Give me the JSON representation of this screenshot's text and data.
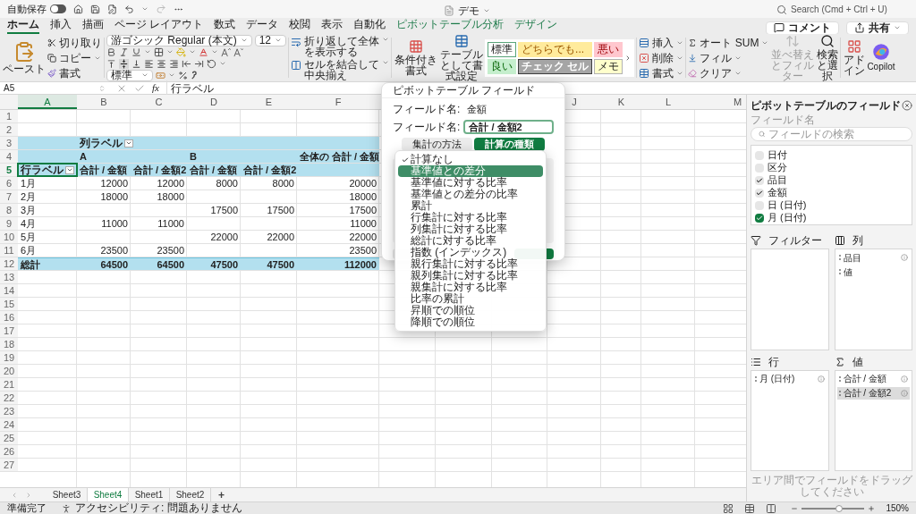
{
  "title_bar": {
    "autosave_label": "自動保存",
    "autosave_on": false,
    "title": "デモ",
    "search_placeholder": "Search (Cmd + Ctrl + U)"
  },
  "tabs": [
    {
      "label": "ホーム",
      "selected": true,
      "kind": "standard"
    },
    {
      "label": "挿入",
      "selected": false,
      "kind": "standard"
    },
    {
      "label": "描画",
      "selected": false,
      "kind": "standard"
    },
    {
      "label": "ページ レイアウト",
      "selected": false,
      "kind": "standard"
    },
    {
      "label": "数式",
      "selected": false,
      "kind": "standard"
    },
    {
      "label": "データ",
      "selected": false,
      "kind": "standard"
    },
    {
      "label": "校閲",
      "selected": false,
      "kind": "standard"
    },
    {
      "label": "表示",
      "selected": false,
      "kind": "standard"
    },
    {
      "label": "自動化",
      "selected": false,
      "kind": "standard"
    },
    {
      "label": "ピボットテーブル分析",
      "selected": false,
      "kind": "contextual"
    },
    {
      "label": "デザイン",
      "selected": false,
      "kind": "contextual"
    }
  ],
  "header_buttons": [
    {
      "label": "コメント",
      "kind": "comment"
    },
    {
      "label": "共有",
      "kind": "share"
    }
  ],
  "ribbon": {
    "paste": "ペースト",
    "cut": "切り取り",
    "copy": "コピー",
    "format_painter": "書式",
    "font_name": "游ゴシック Regular (本文)",
    "font_size": "12",
    "wrap": "折り返して全体を表示する",
    "merge": "セルを結合して中央揃え",
    "number_format": "標準",
    "conditional": "条件付き書式",
    "table_format": "テーブルとして書式設定",
    "cell_styles": [
      {
        "label": "標準",
        "kind": "normal"
      },
      {
        "label": "どちらでも...",
        "kind": "neutral"
      },
      {
        "label": "悪い",
        "kind": "bad"
      },
      {
        "label": "良い",
        "kind": "good"
      },
      {
        "label": "チェック セル",
        "kind": "check"
      },
      {
        "label": "メモ",
        "kind": "note"
      }
    ],
    "cells": [
      {
        "label": "挿入",
        "kind": "insert"
      },
      {
        "label": "削除",
        "kind": "delete"
      },
      {
        "label": "書式",
        "kind": "format"
      }
    ],
    "autosum": "オート SUM",
    "fill": "フィル",
    "clear": "クリア",
    "sort": {
      "label": "並べ替えとフィルター",
      "disabled": true
    },
    "find": "検索と選択",
    "addins": "アドイン",
    "copilot": "Copilot"
  },
  "formula_bar": {
    "cell": "A5",
    "function_symbol": "fx",
    "content": "行ラベル"
  },
  "grid": {
    "columns": [
      {
        "label": "A",
        "selected": true
      },
      {
        "label": "B",
        "selected": false
      },
      {
        "label": "C",
        "selected": false
      },
      {
        "label": "D",
        "selected": false
      },
      {
        "label": "E",
        "selected": false
      },
      {
        "label": "F",
        "selected": false
      },
      null,
      null,
      null,
      {
        "label": "J",
        "selected": false
      },
      {
        "label": "K",
        "selected": false
      },
      {
        "label": "L",
        "selected": false
      },
      {
        "label": "M",
        "selected": false
      }
    ],
    "rows": [
      {
        "number": "1",
        "kind": "blank",
        "selected": false
      },
      {
        "number": "2",
        "kind": "blank",
        "selected": false
      },
      {
        "number": "3",
        "kind": "header",
        "selected": false,
        "cells": [
          null,
          {
            "text": "列ラベル",
            "filter": true
          },
          null,
          null,
          null,
          null
        ]
      },
      {
        "number": "4",
        "kind": "header",
        "selected": false,
        "cells": [
          null,
          {
            "text": "A"
          },
          null,
          {
            "text": "B"
          },
          null,
          {
            "text": "全体の 合計 / 金額"
          }
        ]
      },
      {
        "number": "5",
        "kind": "header",
        "selected": true,
        "cells": [
          {
            "text": "行ラベル",
            "filter": true
          },
          {
            "text": "合計 / 金額"
          },
          {
            "text": "合計 / 金額2"
          },
          {
            "text": "合計 / 金額"
          },
          {
            "text": "合計 / 金額2"
          },
          null
        ]
      },
      {
        "number": "6",
        "kind": "data",
        "selected": false,
        "cells": [
          {
            "text": "1月"
          },
          {
            "text": "12000"
          },
          {
            "text": "12000"
          },
          {
            "text": "8000"
          },
          {
            "text": "8000"
          },
          {
            "text": "20000"
          }
        ]
      },
      {
        "number": "7",
        "kind": "data",
        "selected": false,
        "cells": [
          {
            "text": "2月"
          },
          {
            "text": "18000"
          },
          {
            "text": "18000"
          },
          null,
          null,
          {
            "text": "18000"
          }
        ]
      },
      {
        "number": "8",
        "kind": "data",
        "selected": false,
        "cells": [
          {
            "text": "3月"
          },
          null,
          null,
          {
            "text": "17500"
          },
          {
            "text": "17500"
          },
          {
            "text": "17500"
          }
        ]
      },
      {
        "number": "9",
        "kind": "data",
        "selected": false,
        "cells": [
          {
            "text": "4月"
          },
          {
            "text": "11000"
          },
          {
            "text": "11000"
          },
          null,
          null,
          {
            "text": "11000"
          }
        ]
      },
      {
        "number": "10",
        "kind": "data",
        "selected": false,
        "cells": [
          {
            "text": "5月"
          },
          null,
          null,
          {
            "text": "22000"
          },
          {
            "text": "22000"
          },
          {
            "text": "22000"
          }
        ]
      },
      {
        "number": "11",
        "kind": "data",
        "selected": false,
        "cells": [
          {
            "text": "6月"
          },
          {
            "text": "23500"
          },
          {
            "text": "23500"
          },
          null,
          null,
          {
            "text": "23500"
          }
        ]
      },
      {
        "number": "12",
        "kind": "total",
        "selected": false,
        "cells": [
          {
            "text": "総計"
          },
          {
            "text": "64500"
          },
          {
            "text": "64500"
          },
          {
            "text": "47500"
          },
          {
            "text": "47500"
          },
          {
            "text": "112000"
          }
        ]
      },
      {
        "number": "13",
        "kind": "blank",
        "selected": false
      },
      {
        "number": "14",
        "kind": "blank",
        "selected": false
      },
      {
        "number": "15",
        "kind": "blank",
        "selected": false
      },
      {
        "number": "16",
        "kind": "blank",
        "selected": false
      },
      {
        "number": "17",
        "kind": "blank",
        "selected": false
      },
      {
        "number": "18",
        "kind": "blank",
        "selected": false
      },
      {
        "number": "19",
        "kind": "blank",
        "selected": false
      },
      {
        "number": "20",
        "kind": "blank",
        "selected": false
      },
      {
        "number": "21",
        "kind": "blank",
        "selected": false
      },
      {
        "number": "22",
        "kind": "blank",
        "selected": false
      },
      {
        "number": "23",
        "kind": "blank",
        "selected": false
      },
      {
        "number": "24",
        "kind": "blank",
        "selected": false
      },
      {
        "number": "25",
        "kind": "blank",
        "selected": false
      },
      {
        "number": "26",
        "kind": "blank",
        "selected": false
      },
      {
        "number": "27",
        "kind": "blank",
        "selected": false
      }
    ]
  },
  "sheet_tabs": [
    {
      "label": "Sheet3",
      "selected": false
    },
    {
      "label": "Sheet4",
      "selected": true
    },
    {
      "label": "Sheet1",
      "selected": false
    },
    {
      "label": "Sheet2",
      "selected": false
    }
  ],
  "add_sheet": "+",
  "dialog": {
    "title": "ピボットテーブル フィールド",
    "source_label": "フィールド名:",
    "source_value": "金額",
    "name_label": "フィールド名:",
    "name_value": "合計 / 金額2",
    "tabs": [
      {
        "label": "集計の方法",
        "selected": false
      },
      {
        "label": "計算の種類",
        "selected": true
      }
    ]
  },
  "menu": {
    "items": [
      {
        "label": "計算なし",
        "checked": true,
        "selected": false
      },
      {
        "label": "基準値との差分",
        "checked": false,
        "selected": true
      },
      {
        "label": "基準値に対する比率",
        "checked": false,
        "selected": false
      },
      {
        "label": "基準値との差分の比率",
        "checked": false,
        "selected": false
      },
      {
        "label": "累計",
        "checked": false,
        "selected": false
      },
      {
        "label": "行集計に対する比率",
        "checked": false,
        "selected": false
      },
      {
        "label": "列集計に対する比率",
        "checked": false,
        "selected": false
      },
      {
        "label": "総計に対する比率",
        "checked": false,
        "selected": false
      },
      {
        "label": "指数 (インデックス)",
        "checked": false,
        "selected": false
      },
      {
        "label": "親行集計に対する比率",
        "checked": false,
        "selected": false
      },
      {
        "label": "親列集計に対する比率",
        "checked": false,
        "selected": false
      },
      {
        "label": "親集計に対する比率",
        "checked": false,
        "selected": false
      },
      {
        "label": "比率の累計",
        "checked": false,
        "selected": false
      },
      {
        "label": "昇順での順位",
        "checked": false,
        "selected": false
      },
      {
        "label": "降順での順位",
        "checked": false,
        "selected": false
      }
    ]
  },
  "panel": {
    "title": "ピボットテーブルのフィールド",
    "field_label": "フィールド名",
    "search_placeholder": "フィールドの検索",
    "fields": [
      {
        "label": "日付",
        "checked": false,
        "selected": false
      },
      {
        "label": "区分",
        "checked": false,
        "selected": false
      },
      {
        "label": "品目",
        "checked": true,
        "selected": false
      },
      {
        "label": "金額",
        "checked": true,
        "selected": false
      },
      {
        "label": "日 (日付)",
        "checked": false,
        "selected": false
      },
      {
        "label": "月 (日付)",
        "checked": true,
        "selected": true
      }
    ],
    "areas": [
      {
        "kind": "filter",
        "title": "フィルター"
      },
      {
        "kind": "columns",
        "title": "列",
        "items": [
          {
            "label": "品目",
            "info": true,
            "selected": false
          },
          {
            "label": "値",
            "info": false,
            "selected": false
          }
        ]
      },
      {
        "kind": "rows",
        "title": "行",
        "items": [
          {
            "label": "月 (日付)",
            "info": true,
            "selected": false
          }
        ]
      },
      {
        "kind": "values",
        "title": "値",
        "items": [
          {
            "label": "合計 / 金額",
            "info": true,
            "selected": false
          },
          {
            "label": "合計 / 金額2",
            "info": true,
            "selected": true
          }
        ]
      }
    ],
    "hint": "エリア間でフィールドをドラッグしてください"
  },
  "status_bar": {
    "ready": "準備完了",
    "accessibility": "アクセシビリティ: 問題ありません",
    "zoom": {
      "level": 0.6,
      "reading": "150%"
    }
  }
}
